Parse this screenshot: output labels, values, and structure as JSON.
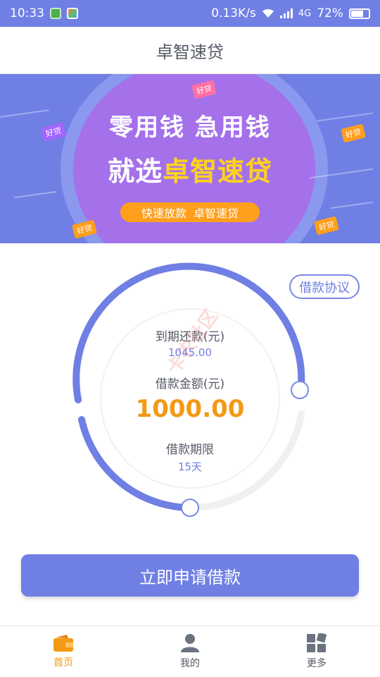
{
  "status_bar": {
    "time": "10:33",
    "speed": "0.13K/s",
    "network": "4G",
    "battery": "72%",
    "battery_level": 0.72
  },
  "header": {
    "title": "卓智速贷"
  },
  "banner": {
    "line1": "零用钱 急用钱",
    "line2_prefix": "就选",
    "line2_highlight": "卓智速贷",
    "pill_left": "快速放款",
    "pill_right": "卓智速贷",
    "tag_text": "好贷"
  },
  "agreement_button": "借款协议",
  "dial": {
    "due_label": "到期还款(元)",
    "due_value": "1045.00",
    "amount_label": "借款金额(元)",
    "amount_value": "1000.00",
    "term_label": "借款期限",
    "term_value": "15天"
  },
  "watermark": "卡农社区",
  "apply_button": "立即申请借款",
  "tabs": [
    {
      "label": "首页",
      "icon": "wallet-icon",
      "active": true
    },
    {
      "label": "我的",
      "icon": "user-icon",
      "active": false
    },
    {
      "label": "更多",
      "icon": "grid-icon",
      "active": false
    }
  ],
  "colors": {
    "primary": "#6f7fe4",
    "accent": "#f29a14",
    "banner_circle": "#a471ea",
    "highlight_yellow": "#ffd21f"
  }
}
